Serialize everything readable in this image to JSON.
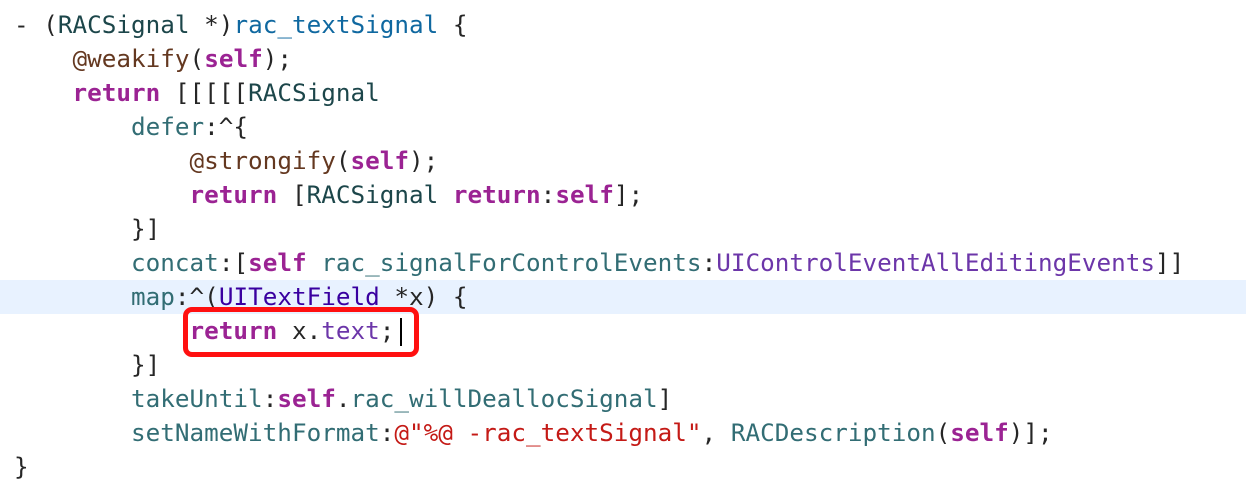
{
  "editor": {
    "current_line": 8,
    "lines": [
      [
        [
          "- (",
          "plain"
        ],
        [
          "RACSignal",
          "type"
        ],
        [
          " *)",
          "plain"
        ],
        [
          "rac_textSignal",
          "decl"
        ],
        [
          " {",
          "plain"
        ]
      ],
      [
        [
          "    ",
          "plain"
        ],
        [
          "@weakify",
          "macro"
        ],
        [
          "(",
          "plain"
        ],
        [
          "self",
          "kw"
        ],
        [
          ");",
          "plain"
        ]
      ],
      [
        [
          "    ",
          "plain"
        ],
        [
          "return",
          "kw"
        ],
        [
          " [[[[[",
          "plain"
        ],
        [
          "RACSignal",
          "type"
        ]
      ],
      [
        [
          "        ",
          "plain"
        ],
        [
          "defer",
          "method"
        ],
        [
          ":^{",
          "plain"
        ]
      ],
      [
        [
          "            ",
          "plain"
        ],
        [
          "@strongify",
          "macro"
        ],
        [
          "(",
          "plain"
        ],
        [
          "self",
          "kw"
        ],
        [
          ");",
          "plain"
        ]
      ],
      [
        [
          "            ",
          "plain"
        ],
        [
          "return",
          "kw"
        ],
        [
          " [",
          "plain"
        ],
        [
          "RACSignal",
          "type"
        ],
        [
          " ",
          "plain"
        ],
        [
          "return",
          "kw"
        ],
        [
          ":",
          "plain"
        ],
        [
          "self",
          "kw"
        ],
        [
          "];",
          "plain"
        ]
      ],
      [
        [
          "        }]",
          "plain"
        ]
      ],
      [
        [
          "        ",
          "plain"
        ],
        [
          "concat",
          "method"
        ],
        [
          ":[",
          "plain"
        ],
        [
          "self",
          "kw"
        ],
        [
          " ",
          "plain"
        ],
        [
          "rac_signalForControlEvents",
          "method"
        ],
        [
          ":",
          "plain"
        ],
        [
          "UIControlEventAllEditingEvents",
          "sysconst"
        ],
        [
          "]]",
          "plain"
        ]
      ],
      [
        [
          "        ",
          "plain"
        ],
        [
          "map",
          "method"
        ],
        [
          ":^(",
          "plain"
        ],
        [
          "UITextField",
          "sysclass"
        ],
        [
          " *x) {",
          "plain"
        ]
      ],
      [
        [
          "            ",
          "plain"
        ],
        [
          "return",
          "kw"
        ],
        [
          " x.",
          "plain"
        ],
        [
          "text",
          "sysconst"
        ],
        [
          ";",
          "plain"
        ]
      ],
      [
        [
          "        }]",
          "plain"
        ]
      ],
      [
        [
          "        ",
          "plain"
        ],
        [
          "takeUntil",
          "method"
        ],
        [
          ":",
          "plain"
        ],
        [
          "self",
          "kw"
        ],
        [
          ".",
          "plain"
        ],
        [
          "rac_willDeallocSignal",
          "method"
        ],
        [
          "]",
          "plain"
        ]
      ],
      [
        [
          "        ",
          "plain"
        ],
        [
          "setNameWithFormat",
          "method"
        ],
        [
          ":",
          "plain"
        ],
        [
          "@\"%@ -rac_textSignal\"",
          "str"
        ],
        [
          ", ",
          "plain"
        ],
        [
          "RACDescription",
          "method"
        ],
        [
          "(",
          "plain"
        ],
        [
          "self",
          "kw"
        ],
        [
          ")];",
          "plain"
        ]
      ],
      [
        [
          "}",
          "plain"
        ]
      ]
    ]
  },
  "colors": {
    "keyword": "#9B2393",
    "type": "#1C464A",
    "method": "#326D74",
    "declaration": "#0F68A0",
    "macro": "#643820",
    "system_class": "#3900A0",
    "system_constant": "#6C36A9",
    "string": "#C41A16",
    "current_line_bg": "#E8F2FF",
    "annotation_box": "#FF1010"
  }
}
